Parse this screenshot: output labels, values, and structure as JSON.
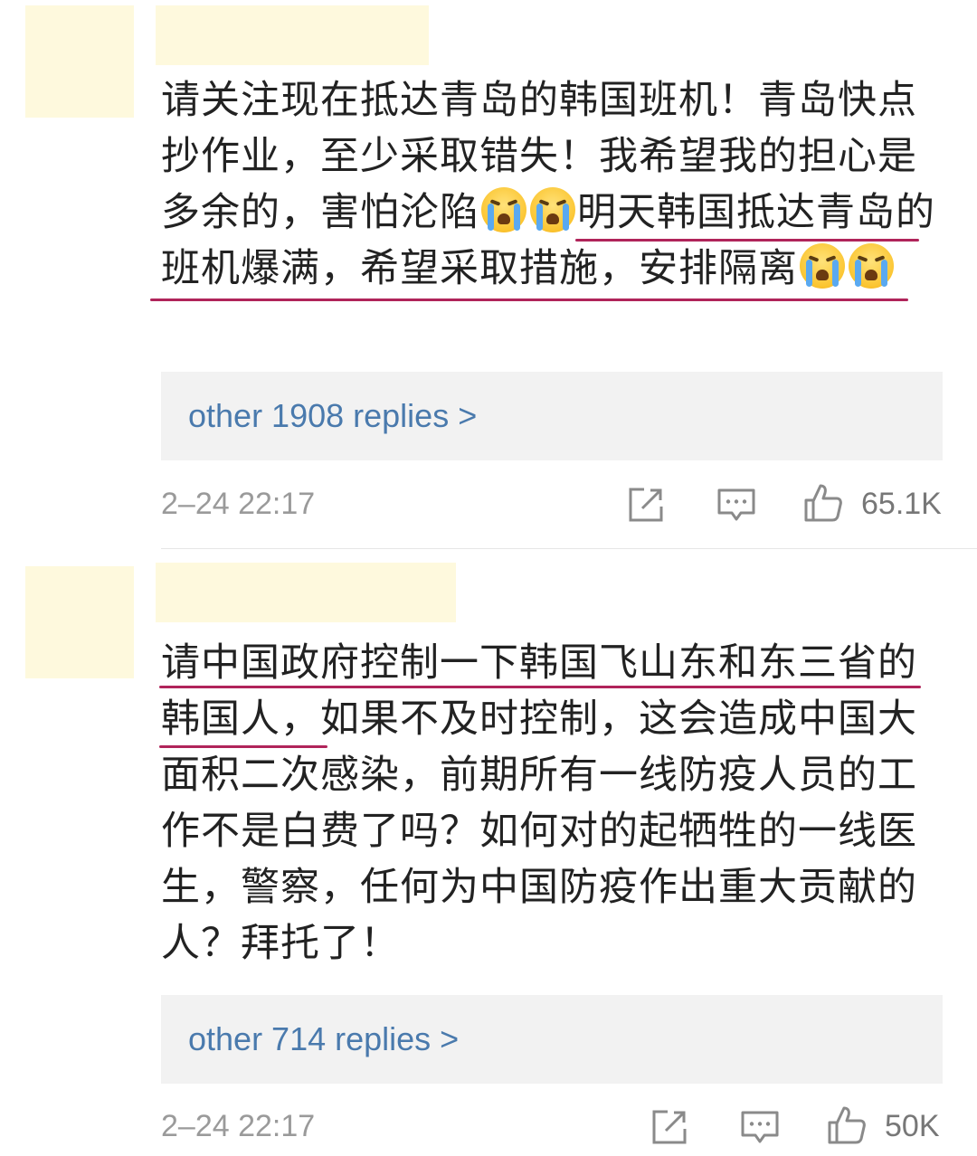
{
  "comments": [
    {
      "text_before_emoji": "请关注现在抵达青岛的韩国班机！青岛快点抄作业，至少采取错失！我希望我的担心是多余的，害怕沦陷",
      "text_middle": "明天韩国抵达青岛的班机爆满，希望采取措施，安排隔离",
      "emoji_name": "loudly-crying-face-emoji",
      "replies_link": "other 1908 replies >",
      "timestamp": "2–24 22:17",
      "like_count": "65.1K"
    },
    {
      "text": "请中国政府控制一下韩国飞山东和东三省的韩国人，如果不及时控制，这会造成中国大面积二次感染，前期所有一线防疫人员的工作不是白费了吗？如何对的起牺牲的一线医生，警察，任何为中国防疫作出重大贡献的人？拜托了！",
      "replies_link": "other 714 replies >",
      "timestamp": "2–24 22:17",
      "like_count": "50K"
    }
  ],
  "colors": {
    "link": "#4a7aad",
    "annotation_underline": "#b0245a",
    "redaction": "#fef9dd"
  },
  "icons": [
    "share-icon",
    "comment-icon",
    "thumbs-up-icon"
  ]
}
